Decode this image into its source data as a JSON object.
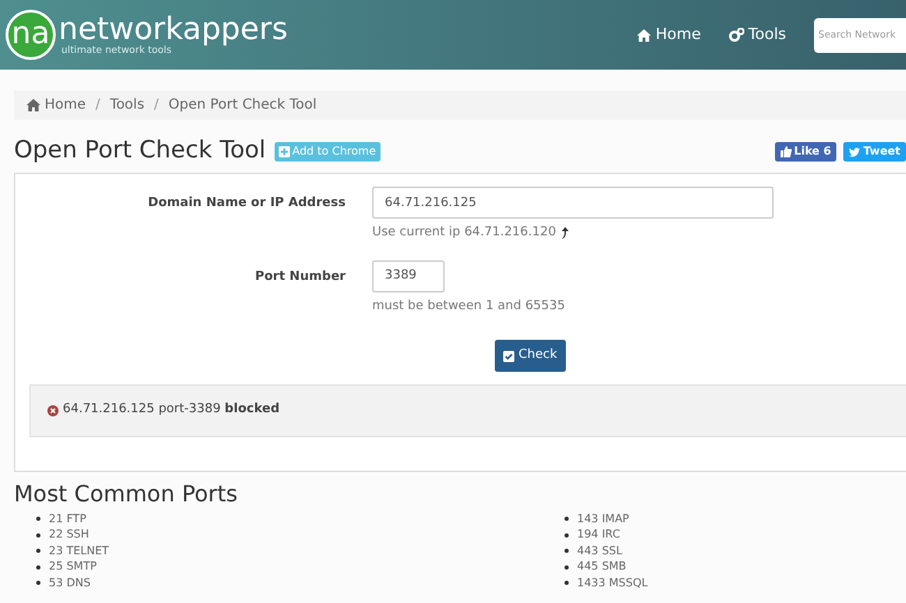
{
  "header": {
    "logo_mark": "na",
    "logo_name": "networkappers",
    "tagline": "ultimate network tools",
    "nav": [
      {
        "label": "Home"
      },
      {
        "label": "Tools"
      }
    ],
    "search": {
      "placeholder": "Search Network"
    }
  },
  "breadcrumb": [
    "Home",
    "Tools",
    "Open Port Check Tool"
  ],
  "breadcrumb_separators": [
    "/",
    "/"
  ],
  "page_title": "Open Port Check Tool",
  "add_button": "Add to Chrome",
  "social": [
    {
      "kind": "like",
      "label": "Like 6"
    },
    {
      "kind": "tweet",
      "label": "Tweet"
    }
  ],
  "form": {
    "fields": [
      {
        "label": "Domain Name or IP Address",
        "value": "64.71.216.125",
        "hint": "Use current ip 64.71.216.120"
      },
      {
        "label": "Port Number",
        "value": "3389",
        "hint": "must be between 1 and 65535"
      }
    ],
    "button": "Check"
  },
  "result": {
    "text": "64.71.216.125 port-3389 **blocked**",
    "kind": "blocked"
  },
  "ports": {
    "title": "Most Common Ports",
    "columns": [
      [
        "21 FTP",
        "22 SSH",
        "23 TELNET",
        "25 SMTP",
        "53 DNS"
      ],
      [
        "143 IMAP",
        "194 IRC",
        "443 SSL",
        "445 SMB",
        "1433 MSSQL"
      ]
    ]
  }
}
